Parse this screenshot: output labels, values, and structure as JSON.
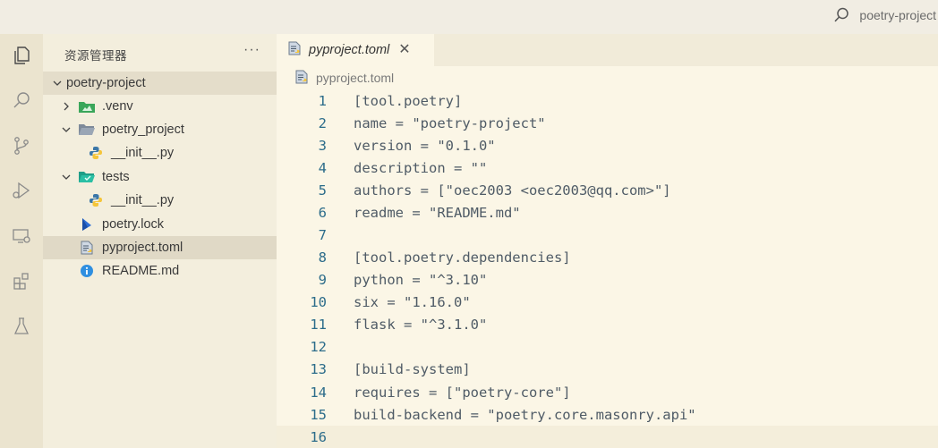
{
  "titlebar": {
    "search_text": "poetry-project"
  },
  "activitybar": {
    "items": [
      {
        "icon": "explorer-icon"
      },
      {
        "icon": "search-icon"
      },
      {
        "icon": "source-control-icon"
      },
      {
        "icon": "run-debug-icon"
      },
      {
        "icon": "remote-explorer-icon"
      },
      {
        "icon": "extensions-icon"
      },
      {
        "icon": "testing-icon"
      }
    ]
  },
  "sidebar": {
    "title": "资源管理器",
    "more": "···",
    "tree": [
      {
        "label": "poetry-project",
        "kind": "root",
        "expanded": true
      },
      {
        "label": ".venv",
        "kind": "folder",
        "expanded": false
      },
      {
        "label": "poetry_project",
        "kind": "folder",
        "expanded": true
      },
      {
        "label": "__init__.py",
        "kind": "python"
      },
      {
        "label": "tests",
        "kind": "folder",
        "expanded": true
      },
      {
        "label": "__init__.py",
        "kind": "python"
      },
      {
        "label": "poetry.lock",
        "kind": "lock"
      },
      {
        "label": "pyproject.toml",
        "kind": "toml",
        "selected": true
      },
      {
        "label": "README.md",
        "kind": "info"
      }
    ]
  },
  "editor": {
    "tab_label": "pyproject.toml",
    "breadcrumb": "pyproject.toml",
    "lines": [
      {
        "n": "1",
        "text": "[tool.poetry]"
      },
      {
        "n": "2",
        "text": "name = \"poetry-project\""
      },
      {
        "n": "3",
        "text": "version = \"0.1.0\""
      },
      {
        "n": "4",
        "text": "description = \"\""
      },
      {
        "n": "5",
        "text": "authors = [\"oec2003 <oec2003@qq.com>\"]"
      },
      {
        "n": "6",
        "text": "readme = \"README.md\""
      },
      {
        "n": "7",
        "text": ""
      },
      {
        "n": "8",
        "text": "[tool.poetry.dependencies]"
      },
      {
        "n": "9",
        "text": "python = \"^3.10\""
      },
      {
        "n": "10",
        "text": "six = \"1.16.0\""
      },
      {
        "n": "11",
        "text": "flask = \"^3.1.0\""
      },
      {
        "n": "12",
        "text": ""
      },
      {
        "n": "13",
        "text": "[build-system]"
      },
      {
        "n": "14",
        "text": "requires = [\"poetry-core\"]"
      },
      {
        "n": "15",
        "text": "build-backend = \"poetry.core.masonry.api\""
      },
      {
        "n": "16",
        "text": ""
      }
    ]
  },
  "colors": {
    "line_number": "#2c6c8a",
    "code_text": "#4f5b66",
    "python_icon_blue": "#3b77a8",
    "python_icon_yellow": "#f5c53a",
    "info_blue": "#2f8fe0",
    "venv_green": "#3aa65a"
  }
}
